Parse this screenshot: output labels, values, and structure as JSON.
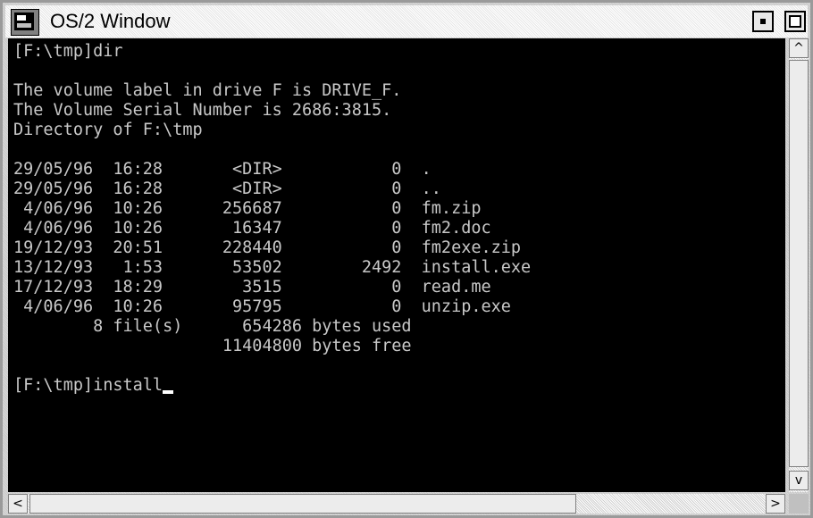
{
  "window": {
    "title": "OS/2 Window",
    "system_menu_icon": "os2-window-icon",
    "buttons": {
      "minimize_icon": "minimize-icon",
      "maximize_icon": "maximize-icon"
    }
  },
  "console": {
    "lines": [
      "[F:\\tmp]dir",
      "",
      "The volume label in drive F is DRIVE_F.",
      "The Volume Serial Number is 2686:3815.",
      "Directory of F:\\tmp",
      "",
      "29/05/96  16:28       <DIR>           0  .",
      "29/05/96  16:28       <DIR>           0  ..",
      " 4/06/96  10:26      256687           0  fm.zip",
      " 4/06/96  10:26       16347           0  fm2.doc",
      "19/12/93  20:51      228440           0  fm2exe.zip",
      "13/12/93   1:53       53502        2492  install.exe",
      "17/12/93  18:29        3515           0  read.me",
      " 4/06/96  10:26       95795           0  unzip.exe",
      "        8 file(s)      654286 bytes used",
      "                     11404800 bytes free",
      "",
      "[F:\\tmp]install"
    ]
  },
  "scrollbars": {
    "up_glyph": "^",
    "down_glyph": "v",
    "left_glyph": "<",
    "right_glyph": ">"
  }
}
